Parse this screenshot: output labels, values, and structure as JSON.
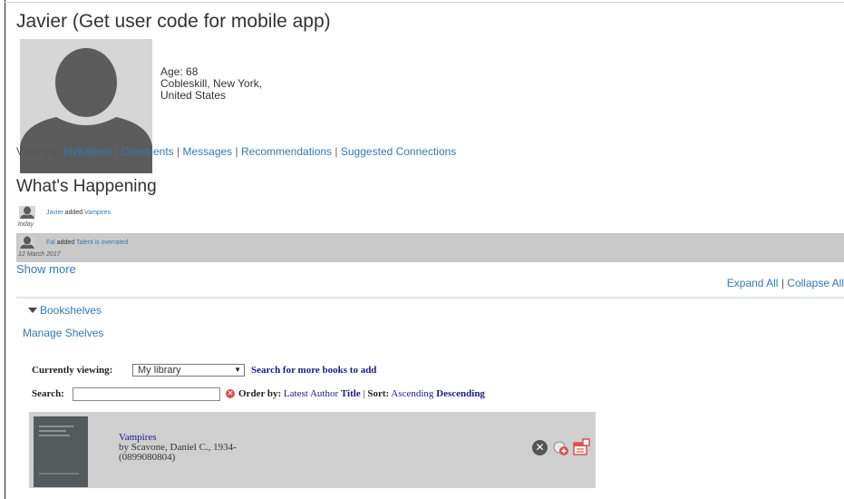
{
  "profile": {
    "title": "Javier (Get user code for mobile app)",
    "age_label": "Age: 68",
    "location_line1": "Cobleskill, New York,",
    "location_line2": "United States"
  },
  "view_my": {
    "label": "View my:",
    "links": [
      "Invitations",
      "Comments",
      "Messages",
      "Recommendations",
      "Suggested Connections"
    ],
    "separator": "|"
  },
  "whats_happening": {
    "heading": "What's Happening",
    "items": [
      {
        "user": "Javier",
        "action": "added",
        "item": "Vampires",
        "date": "today"
      },
      {
        "user": "Fal",
        "action": "added",
        "item": "Talent is overrated",
        "date": "12 March 2017"
      }
    ],
    "show_more": "Show more"
  },
  "controls": {
    "expand_all": "Expand All",
    "collapse_all": "Collapse All",
    "separator": "|"
  },
  "bookshelves": {
    "heading": "Bookshelves",
    "manage": "Manage Shelves",
    "currently_viewing_label": "Currently viewing:",
    "selected_shelf": "My library",
    "search_more": "Search for more books to add",
    "search_label": "Search:",
    "search_value": "",
    "order_by_label": "Order by:",
    "order_latest": "Latest",
    "order_author": "Author",
    "order_title": "Title",
    "sort_label": "Sort:",
    "sort_ascending": "Ascending",
    "sort_descending": "Descending",
    "books": [
      {
        "title": "Vampires",
        "author": "by Scavone, Daniel C., 1934-",
        "isbn": "(0899080804)"
      }
    ]
  },
  "colors": {
    "link": "#337ab7",
    "serif_link": "#1a1a8c",
    "activity_alt_bg": "#c9c9c9",
    "book_row_bg": "#cfcfcf"
  }
}
